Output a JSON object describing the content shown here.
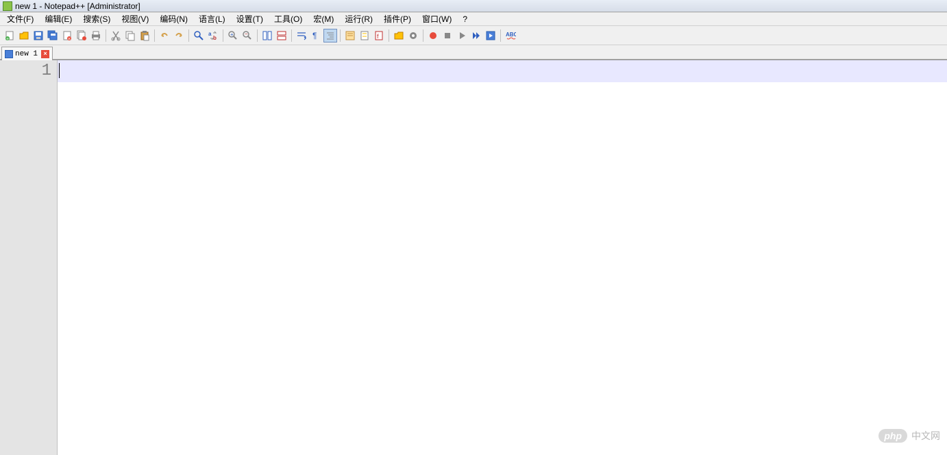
{
  "titlebar": {
    "title": "new 1 - Notepad++ [Administrator]"
  },
  "menubar": {
    "items": [
      {
        "label": "文件(F)",
        "key": "F"
      },
      {
        "label": "编辑(E)",
        "key": "E"
      },
      {
        "label": "搜索(S)",
        "key": "S"
      },
      {
        "label": "视图(V)",
        "key": "V"
      },
      {
        "label": "编码(N)",
        "key": "N"
      },
      {
        "label": "语言(L)",
        "key": "L"
      },
      {
        "label": "设置(T)",
        "key": "T"
      },
      {
        "label": "工具(O)",
        "key": "O"
      },
      {
        "label": "宏(M)",
        "key": "M"
      },
      {
        "label": "运行(R)",
        "key": "R"
      },
      {
        "label": "插件(P)",
        "key": "P"
      },
      {
        "label": "窗口(W)",
        "key": "W"
      },
      {
        "label": "?",
        "key": "?"
      }
    ]
  },
  "toolbar": {
    "buttons": [
      {
        "name": "new-file",
        "group": 0
      },
      {
        "name": "open-file",
        "group": 0
      },
      {
        "name": "save",
        "group": 0
      },
      {
        "name": "save-all",
        "group": 0
      },
      {
        "name": "close",
        "group": 0
      },
      {
        "name": "close-all",
        "group": 0
      },
      {
        "name": "print",
        "group": 0
      },
      {
        "name": "cut",
        "group": 1
      },
      {
        "name": "copy",
        "group": 1
      },
      {
        "name": "paste",
        "group": 1
      },
      {
        "name": "undo",
        "group": 2
      },
      {
        "name": "redo",
        "group": 2
      },
      {
        "name": "find",
        "group": 3
      },
      {
        "name": "replace",
        "group": 3
      },
      {
        "name": "zoom-in",
        "group": 4
      },
      {
        "name": "zoom-out",
        "group": 4
      },
      {
        "name": "sync-v",
        "group": 5
      },
      {
        "name": "sync-h",
        "group": 5
      },
      {
        "name": "word-wrap",
        "group": 6
      },
      {
        "name": "show-all-chars",
        "group": 6
      },
      {
        "name": "indent-guide",
        "group": 6,
        "active": true
      },
      {
        "name": "lang-format",
        "group": 7
      },
      {
        "name": "doc-map",
        "group": 7
      },
      {
        "name": "function-list",
        "group": 7
      },
      {
        "name": "folder-workspace",
        "group": 8
      },
      {
        "name": "monitor",
        "group": 8
      },
      {
        "name": "record-macro",
        "group": 9
      },
      {
        "name": "stop-macro",
        "group": 9
      },
      {
        "name": "play-macro",
        "group": 9
      },
      {
        "name": "fast-forward",
        "group": 9
      },
      {
        "name": "save-macro",
        "group": 9
      },
      {
        "name": "spell-check",
        "group": 10
      }
    ]
  },
  "tabs": [
    {
      "label": "new 1",
      "active": true
    }
  ],
  "editor": {
    "lines": [
      "1"
    ],
    "active_line": 0
  },
  "watermark": {
    "badge": "php",
    "text": "中文网"
  }
}
